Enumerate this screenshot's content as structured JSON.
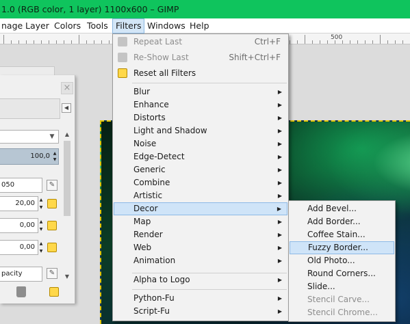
{
  "window": {
    "title": "1.0 (RGB color, 1 layer) 1100x600 – GIMP"
  },
  "menubar": [
    {
      "id": "image",
      "label": "nage"
    },
    {
      "id": "layer",
      "label": "Layer"
    },
    {
      "id": "colors",
      "label": "Colors"
    },
    {
      "id": "tools",
      "label": "Tools"
    },
    {
      "id": "filters",
      "label": "Filters"
    },
    {
      "id": "windows",
      "label": "Windows"
    },
    {
      "id": "help",
      "label": "Help"
    }
  ],
  "ruler": {
    "label": "500"
  },
  "tool_options": {
    "opacity_value": "100,0",
    "brush_name": "050",
    "size_value": "20,00",
    "aspect_value": "0,00",
    "angle_value": "0,00",
    "dynamics_name": "pacity"
  },
  "filters_menu": {
    "top_items": [
      {
        "label": "Repeat Last",
        "accel": "Ctrl+F",
        "disabled": true,
        "icon": "repeat-icon"
      },
      {
        "label": "Re-Show Last",
        "accel": "Shift+Ctrl+F",
        "disabled": true,
        "icon": "reshow-icon"
      },
      {
        "label": "Reset all Filters",
        "accel": "",
        "disabled": false,
        "icon": "reset-icon"
      }
    ],
    "submenus_a": [
      "Blur",
      "Enhance",
      "Distorts",
      "Light and Shadow",
      "Noise",
      "Edge-Detect",
      "Generic",
      "Combine",
      "Artistic",
      "Decor",
      "Map",
      "Render",
      "Web",
      "Animation"
    ],
    "highlighted": "Decor",
    "alpha_to_logo": "Alpha to Logo",
    "submenus_b": [
      "Python-Fu",
      "Script-Fu"
    ]
  },
  "decor_menu": {
    "items": [
      {
        "label": "Add Bevel...",
        "disabled": false
      },
      {
        "label": "Add Border...",
        "disabled": false
      },
      {
        "label": "Coffee Stain...",
        "disabled": false
      },
      {
        "label": "Fuzzy Border...",
        "disabled": false
      },
      {
        "label": "Old Photo...",
        "disabled": false
      },
      {
        "label": "Round Corners...",
        "disabled": false
      },
      {
        "label": "Slide...",
        "disabled": false
      },
      {
        "label": "Stencil Carve...",
        "disabled": true
      },
      {
        "label": "Stencil Chrome...",
        "disabled": true
      }
    ],
    "highlighted": "Fuzzy Border..."
  }
}
